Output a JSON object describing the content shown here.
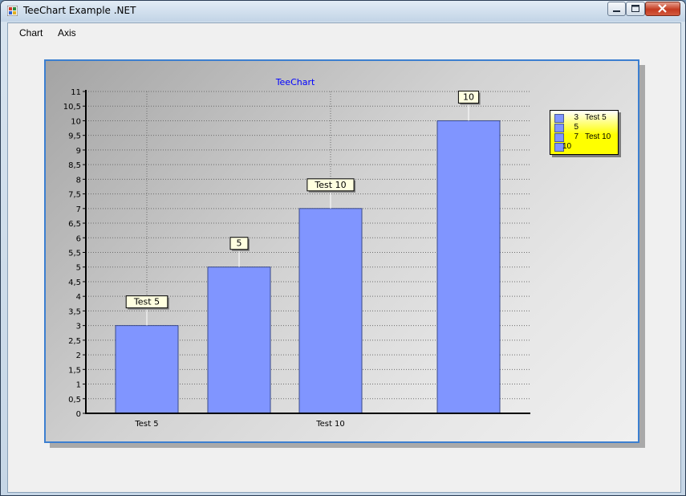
{
  "window": {
    "title": "TeeChart Example .NET"
  },
  "menu": {
    "items": [
      "Chart",
      "Axis"
    ]
  },
  "colors": {
    "bar_fill": "#8095ff",
    "bar_edge": "#3a4a88",
    "title_color": "#0000ff",
    "legend_bg": "#ffff00"
  },
  "chart_data": {
    "type": "bar",
    "title": "TeeChart",
    "xlabel": "",
    "ylabel": "",
    "ylim": [
      0,
      11
    ],
    "y_ticks": [
      "0",
      "0,5",
      "1",
      "1,5",
      "2",
      "2,5",
      "3",
      "3,5",
      "4",
      "4,5",
      "5",
      "5,5",
      "6",
      "6,5",
      "7",
      "7,5",
      "8",
      "8,5",
      "9",
      "9,5",
      "10",
      "10,5",
      "11"
    ],
    "x_tick_labels": [
      "Test 5",
      "",
      "Test 10",
      ""
    ],
    "categories": [
      "Test 5",
      "",
      "Test 10",
      ""
    ],
    "values": [
      3,
      5,
      7,
      10
    ],
    "marks": [
      "Test 5",
      "5",
      "Test 10",
      "10"
    ],
    "grid": true,
    "legend_position": "right",
    "legend": [
      {
        "value": "3",
        "label": "Test 5"
      },
      {
        "value": "5",
        "label": ""
      },
      {
        "value": "7",
        "label": "Test 10"
      },
      {
        "value": "10",
        "label": ""
      }
    ]
  }
}
